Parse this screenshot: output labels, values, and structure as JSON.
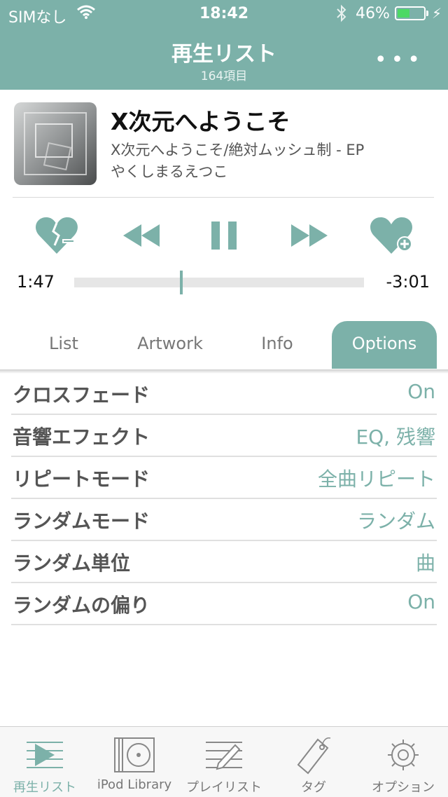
{
  "status_bar": {
    "carrier": "SIMなし",
    "time": "18:42",
    "battery_percent": "46%",
    "battery_level": 0.46
  },
  "header": {
    "title": "再生リスト",
    "subtitle": "164項目",
    "more_icon": "ellipsis-icon"
  },
  "now_playing": {
    "title": "X次元へようこそ",
    "album": "X次元へようこそ/絶対ムッシュ制 - EP",
    "artist": "やくしまるえつこ"
  },
  "controls": [
    "dislike-heart-icon",
    "rewind-icon",
    "pause-icon",
    "fast-forward-icon",
    "like-heart-icon"
  ],
  "progress": {
    "elapsed": "1:47",
    "remaining": "-3:01",
    "fraction": 0.37
  },
  "tabs": [
    {
      "label": "List",
      "active": false
    },
    {
      "label": "Artwork",
      "active": false
    },
    {
      "label": "Info",
      "active": false
    },
    {
      "label": "Options",
      "active": true
    }
  ],
  "options": [
    {
      "label": "クロスフェード",
      "value": "On"
    },
    {
      "label": "音響エフェクト",
      "value": "EQ, 残響"
    },
    {
      "label": "リピートモード",
      "value": "全曲リピート"
    },
    {
      "label": "ランダムモード",
      "value": "ランダム"
    },
    {
      "label": "ランダム単位",
      "value": "曲"
    },
    {
      "label": "ランダムの偏り",
      "value": "On"
    }
  ],
  "bottom_tabs": [
    {
      "label": "再生リスト",
      "icon": "playlist-play-icon",
      "active": true
    },
    {
      "label": "iPod Library",
      "icon": "ipod-library-icon",
      "active": false
    },
    {
      "label": "プレイリスト",
      "icon": "playlist-edit-icon",
      "active": false
    },
    {
      "label": "タグ",
      "icon": "tag-icon",
      "active": false
    },
    {
      "label": "オプション",
      "icon": "gear-icon",
      "active": false
    }
  ],
  "colors": {
    "accent": "#7cb1a9",
    "battery_fill": "#4cd964"
  }
}
